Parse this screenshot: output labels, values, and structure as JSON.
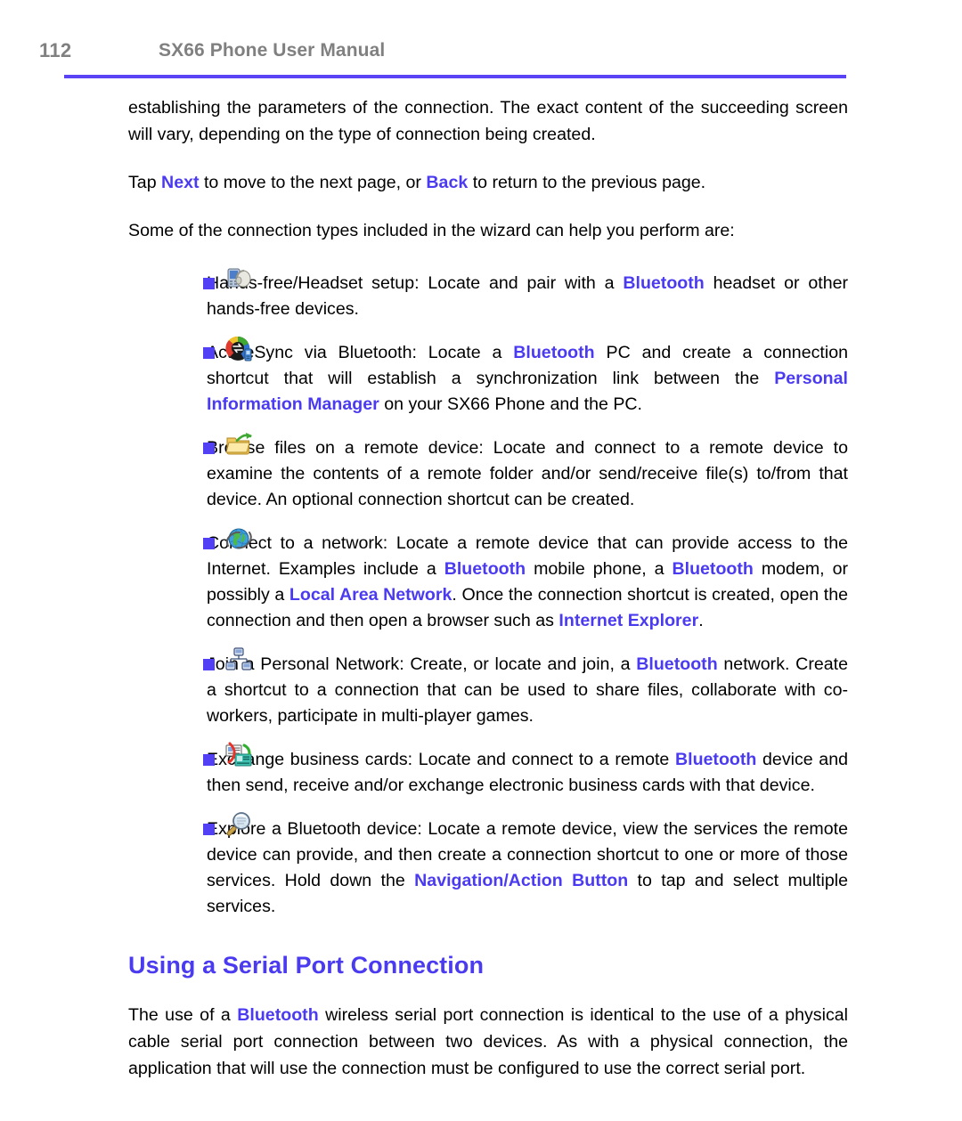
{
  "header": {
    "page_number": "112",
    "title": "SX66 Phone User Manual",
    "rule_color": "#5a43f5"
  },
  "colors": {
    "accent_blue": "#4b3bf0",
    "bullet_square": "#5240f5",
    "header_gray": "#808080"
  },
  "body": {
    "paragraph_1": "establishing the parameters of the connection. The exact content of the succeeding screen will vary, depending on the type of connection being created.",
    "paragraph_2_pre": "Tap ",
    "paragraph_2_next": "Next",
    "paragraph_2_mid": " to move to the next page, or ",
    "paragraph_2_back": "Back",
    "paragraph_2_post": " to return to the previous page.",
    "paragraph_3": "Some of the connection types included in the wizard can help you perform are:"
  },
  "bullets": [
    {
      "icon": "headset-icon",
      "segments": [
        {
          "text": "Hands-free/Headset setup: Locate and pair with a ",
          "style": "normal"
        },
        {
          "text": "Bluetooth",
          "style": "blue"
        },
        {
          "text": " headset or other hands-free devices.",
          "style": "normal"
        }
      ]
    },
    {
      "icon": "activesync-icon",
      "segments": [
        {
          "text": "ActiveSync via Bluetooth: Locate a ",
          "style": "normal"
        },
        {
          "text": "Bluetooth",
          "style": "blue"
        },
        {
          "text": " PC and create a connection shortcut that will establish a synchronization link between the ",
          "style": "normal"
        },
        {
          "text": "Personal Information Manager",
          "style": "blue"
        },
        {
          "text": " on your SX66 Phone and the PC.",
          "style": "normal"
        }
      ]
    },
    {
      "icon": "folder-browse-icon",
      "segments": [
        {
          "text": "Browse files on a remote device: Locate and connect to a remote device to examine the contents of a remote folder and/or send/receive file(s) to/from that device. An optional connection shortcut can be created.",
          "style": "normal"
        }
      ]
    },
    {
      "icon": "globe-network-icon",
      "segments": [
        {
          "text": "Connect to a network: Locate a remote device that can provide access to the Internet. Examples include a ",
          "style": "normal"
        },
        {
          "text": "Bluetooth",
          "style": "blue"
        },
        {
          "text": " mobile phone, a ",
          "style": "normal"
        },
        {
          "text": "Bluetooth",
          "style": "blue"
        },
        {
          "text": " modem, or possibly a ",
          "style": "normal"
        },
        {
          "text": "Local Area Network",
          "style": "blue"
        },
        {
          "text": ". Once the connection shortcut is created, open the connection and then open a browser such as ",
          "style": "normal"
        },
        {
          "text": "Internet Explorer",
          "style": "blue"
        },
        {
          "text": ".",
          "style": "normal"
        }
      ]
    },
    {
      "icon": "personal-network-icon",
      "segments": [
        {
          "text": "Join a Personal Network: Create, or locate and join, a ",
          "style": "normal"
        },
        {
          "text": "Bluetooth",
          "style": "blue"
        },
        {
          "text": " network. Create a shortcut to a connection that can be used to share files, collaborate with co-workers, participate in multi-player games.",
          "style": "normal"
        }
      ]
    },
    {
      "icon": "business-cards-icon",
      "segments": [
        {
          "text": "Exchange business cards: Locate and connect to a remote ",
          "style": "normal"
        },
        {
          "text": "Bluetooth",
          "style": "blue"
        },
        {
          "text": " device and then send, receive and/or exchange electronic business cards with that device.",
          "style": "normal"
        }
      ]
    },
    {
      "icon": "magnifier-explore-icon",
      "segments": [
        {
          "text": "Explore a Bluetooth device: Locate a remote device, view the services the remote device can provide, and then create a connection shortcut to one or more of those services. Hold down the ",
          "style": "normal"
        },
        {
          "text": "Navigation/Action Button",
          "style": "blue"
        },
        {
          "text": " to tap and select multiple services.",
          "style": "normal"
        }
      ]
    }
  ],
  "section": {
    "heading": "Using a Serial Port Connection",
    "paragraph_pre": "The use of a ",
    "paragraph_bluetooth": "Bluetooth",
    "paragraph_post": " wireless serial port connection is identical to the use of a physical cable serial port connection between two devices. As with a physical connection, the application that will use the connection must be configured to use the correct serial port."
  }
}
